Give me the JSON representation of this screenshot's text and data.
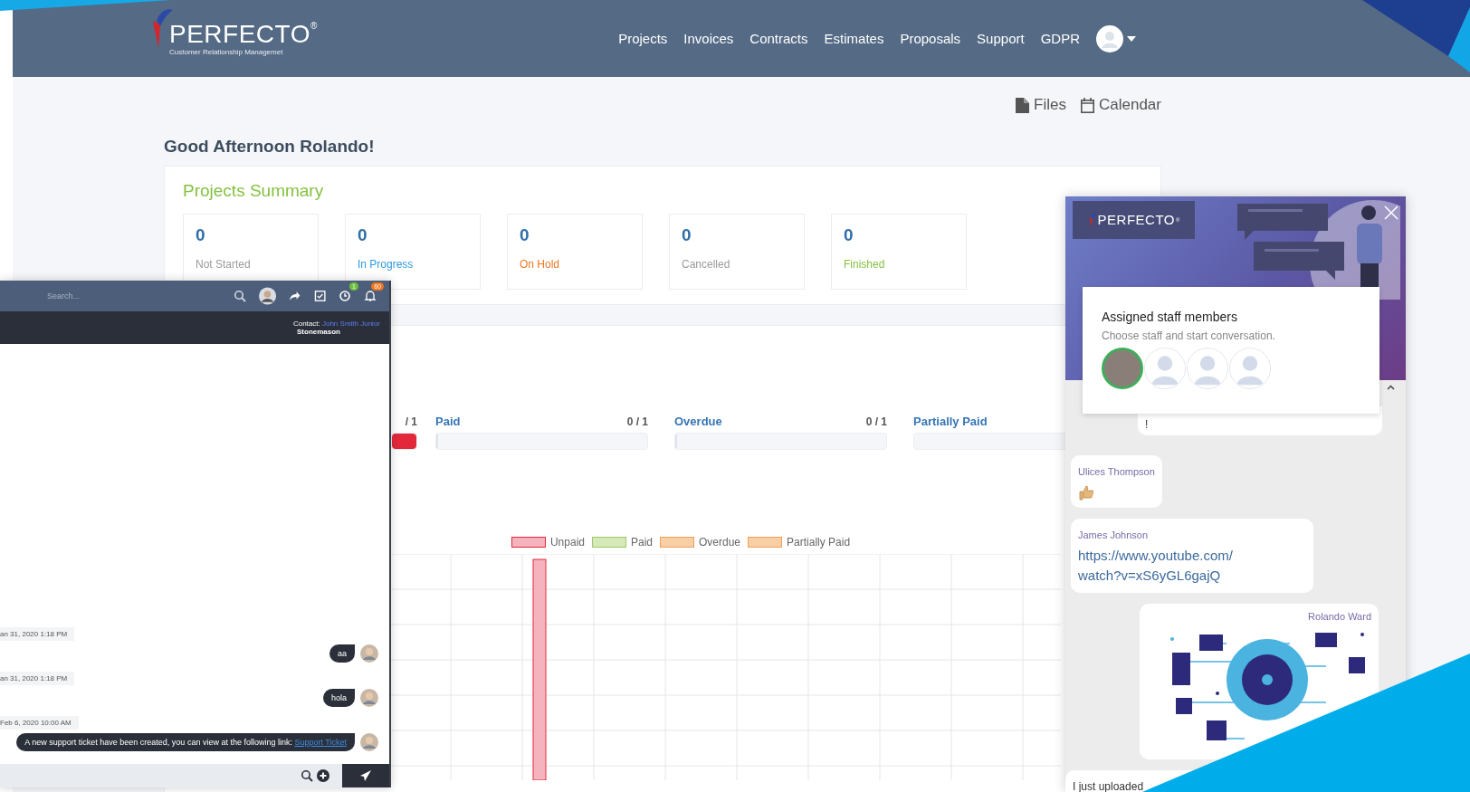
{
  "nav": {
    "logo": {
      "name": "PERFECTO",
      "mark": "®",
      "tagline": "Customer Relationship Managemet"
    },
    "items": [
      "Projects",
      "Invoices",
      "Contracts",
      "Estimates",
      "Proposals",
      "Support",
      "GDPR"
    ]
  },
  "quick_links": [
    "Files",
    "Calendar"
  ],
  "greeting": "Good Afternoon Rolando!",
  "projects_summary": {
    "title": "Projects Summary",
    "tiles": [
      {
        "count": "0",
        "label": "Not Started",
        "color": "#9a9a9a"
      },
      {
        "count": "0",
        "label": "In Progress",
        "color": "#2d9be0"
      },
      {
        "count": "0",
        "label": "On Hold",
        "color": "#f0761f"
      },
      {
        "count": "0",
        "label": "Cancelled",
        "color": "#9a9a9a"
      },
      {
        "count": "0",
        "label": "Finished",
        "color": "#84c241"
      }
    ]
  },
  "invoice_progress": [
    {
      "count": "/ 1",
      "level": 1
    },
    {
      "label": "Paid",
      "count": "0 / 1",
      "level": 0
    },
    {
      "label": "Overdue",
      "count": "0 / 1",
      "level": 0
    },
    {
      "label": "Partially Paid"
    }
  ],
  "chart": {
    "legend": [
      {
        "label": "Unpaid",
        "color": "#f5b3bd"
      },
      {
        "label": "Paid",
        "color": "#d6e9b8"
      },
      {
        "label": "Overdue",
        "color": "#f9cfa6"
      },
      {
        "label": "Partially Paid",
        "color": "#f9cfa6"
      }
    ]
  },
  "chat_window": {
    "search": {
      "placeholder": "Search..."
    },
    "timer_badge": "1",
    "notification_badge": "60",
    "contact": {
      "label": "Contact:",
      "name": "John Smith Junior",
      "role": "Stonemason"
    },
    "messages": [
      {
        "kind": "date",
        "text": "an 31, 2020 1:18 PM"
      },
      {
        "kind": "sent",
        "text": "aa"
      },
      {
        "kind": "date",
        "text": "an 31, 2020 1:18 PM"
      },
      {
        "kind": "sent",
        "text": "hola"
      },
      {
        "kind": "date",
        "text": "Feb 6, 2020 10:00 AM"
      },
      {
        "kind": "sent",
        "text": "A new support ticket have been created, you can view at the following link:",
        "link": "Support Ticket"
      }
    ]
  },
  "staff_widget": {
    "logo": {
      "name": "PERFECTO",
      "mark": "®"
    },
    "title": "Assigned staff members",
    "subtitle": "Choose staff and start conversation.",
    "staff": [
      {
        "kind": "photo",
        "selected": true
      },
      {
        "kind": "placeholder",
        "selected": false
      },
      {
        "kind": "placeholder",
        "selected": false
      },
      {
        "kind": "placeholder",
        "selected": false
      }
    ],
    "messages": [
      {
        "kind": "text",
        "text": "!"
      },
      {
        "kind": "emoji",
        "author": "Ulices Thompson"
      },
      {
        "kind": "link",
        "author": "James Johnson",
        "text": "https://www.youtube.com/watch?v=xS6yGL6gajQ"
      },
      {
        "kind": "image",
        "author": "Rolando Ward"
      },
      {
        "kind": "text",
        "text": "I just uploaded"
      }
    ]
  }
}
